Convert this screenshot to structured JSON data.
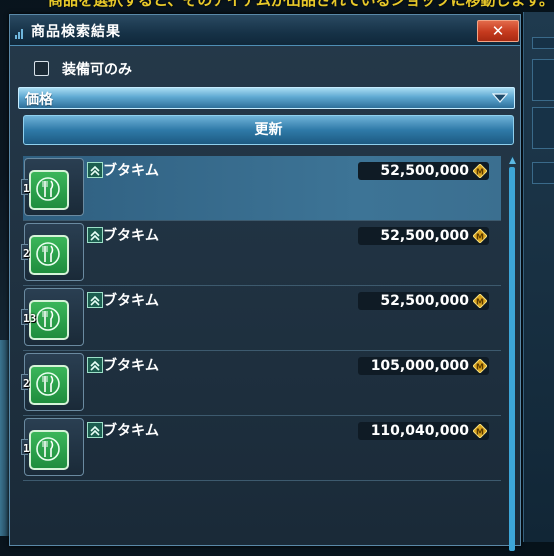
{
  "background": {
    "ticker_text": "商品を選択すると、そのアイテムが出品されているショップに移動します。"
  },
  "window": {
    "title": "商品検索結果",
    "close_label": "✕"
  },
  "filter": {
    "checkbox_label": "装備可のみ",
    "checked": false
  },
  "sort": {
    "selected": "価格"
  },
  "refresh_label": "更新",
  "colors": {
    "accent": "#4ea7d6",
    "close": "#c53a1e",
    "item_icon": "#2aa04a",
    "meseta": "#d9a21a"
  },
  "results": [
    {
      "qty": "1",
      "name": "ブタキム",
      "price": "52,500,000",
      "icon": "food-icon",
      "selected": true
    },
    {
      "qty": "2",
      "name": "ブタキム",
      "price": "52,500,000",
      "icon": "food-icon",
      "selected": false
    },
    {
      "qty": "13",
      "name": "ブタキム",
      "price": "52,500,000",
      "icon": "food-icon",
      "selected": false
    },
    {
      "qty": "2",
      "name": "ブタキム",
      "price": "105,000,000",
      "icon": "food-icon",
      "selected": false
    },
    {
      "qty": "1",
      "name": "ブタキム",
      "price": "110,040,000",
      "icon": "food-icon",
      "selected": false
    }
  ]
}
